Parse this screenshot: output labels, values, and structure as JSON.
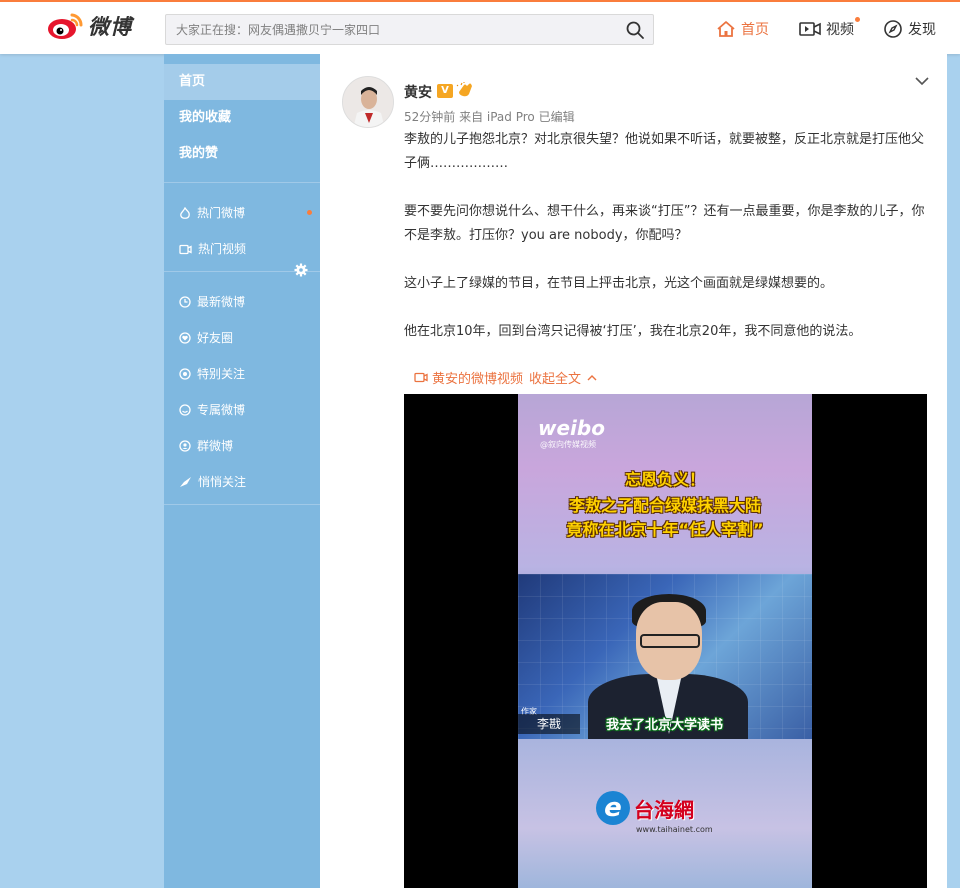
{
  "header": {
    "brand": "微博",
    "search_placeholder": "大家正在搜：网友偶遇撒贝宁一家四口",
    "nav": [
      {
        "label": "首页",
        "icon": "home-icon",
        "active": true
      },
      {
        "label": "视频",
        "icon": "video-icon"
      },
      {
        "label": "发现",
        "icon": "compass-icon"
      }
    ]
  },
  "sidebar": {
    "main_items": [
      {
        "label": "首页",
        "active": true
      },
      {
        "label": "我的收藏"
      },
      {
        "label": "我的赞"
      }
    ],
    "hot_items": [
      {
        "label": "热门微博",
        "icon": "fire-icon"
      },
      {
        "label": "热门视频",
        "icon": "video-icon"
      }
    ],
    "group_items": [
      {
        "label": "最新微博",
        "icon": "clock-icon"
      },
      {
        "label": "好友圈",
        "icon": "heart-icon"
      },
      {
        "label": "特别关注",
        "icon": "star-icon"
      },
      {
        "label": "专属微博",
        "icon": "smile-icon"
      },
      {
        "label": "群微博",
        "icon": "group-icon"
      },
      {
        "label": "悄悄关注",
        "icon": "whisper-icon"
      }
    ]
  },
  "post": {
    "author": "黄安",
    "verified_badge": "V",
    "meta": "52分钟前 来自 iPad Pro   已编辑",
    "paragraphs": [
      "李敖的儿子抱怨北京？对北京很失望？他说如果不听话，就要被整，反正北京就是打压他父子俩………………",
      "要不要先问你想说什么、想干什么，再来谈“打压”？还有一点最重要，你是李敖的儿子，你不是李敖。打压你？you are nobody，你配吗？",
      "这小子上了绿媒的节目，在节目上抨击北京，光这个画面就是绿媒想要的。",
      "他在北京10年，回到台湾只记得被‘打压’，我在北京20年，我不同意他的说法。"
    ],
    "video_link": "黄安的微博视频",
    "collapse_label": "收起全文",
    "video": {
      "watermark": "weibo",
      "watermark_sub": "@叙向传媒视频",
      "headline_1": "忘恩负义！",
      "headline_2": "李敖之子配合绿媒抹黑大陆",
      "headline_3": "竟称在北京十年“任人宰割”",
      "name_top": "作家",
      "name": "李戡",
      "caption": "我去了北京大学读书",
      "source_text": "台海網",
      "source_url": "www.taihainet.com"
    }
  },
  "colors": {
    "accent": "#fa7d3c",
    "sidebar": "#7fb8e0",
    "page_bg": "#a9d1ee"
  }
}
